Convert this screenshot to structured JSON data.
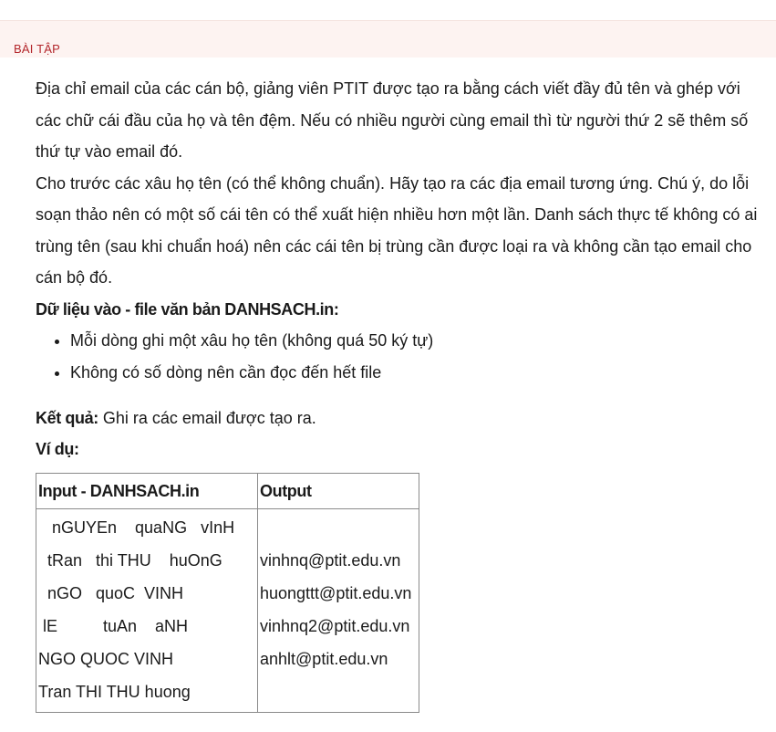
{
  "section": {
    "label": "BÀI TẬP"
  },
  "problem": {
    "paragraph1": "Địa chỉ email của các cán bộ, giảng viên PTIT được tạo ra bằng cách viết đầy đủ tên và ghép với các chữ cái đầu của họ và tên đệm. Nếu có nhiều người cùng email thì từ người thứ 2 sẽ thêm số thứ tự vào email đó.",
    "paragraph2": "Cho trước các xâu họ tên (có thể không chuẩn). Hãy tạo ra các địa email tương ứng. Chú ý, do lỗi soạn thảo nên có một số cái tên có thể xuất hiện nhiều hơn một lần. Danh sách thực tế không có ai trùng tên (sau khi chuẩn hoá) nên các cái tên bị trùng cần được loại ra và không cần tạo email cho cán bộ đó.",
    "input_heading": "Dữ liệu vào - file văn bản DANHSACH.in:",
    "input_items": [
      "Mỗi dòng ghi một xâu họ tên (không quá 50 ký tự)",
      "Không có số dòng nên cần đọc đến hết file"
    ],
    "result_label": "Kết quả:",
    "result_text": " Ghi ra các email được tạo ra.",
    "example_label": "Ví dụ:"
  },
  "example_table": {
    "headers": [
      "Input - DANHSACH.in",
      "Output"
    ],
    "input_lines": [
      "   nGUYEn    quaNG   vInH",
      "  tRan   thi THU    huOnG",
      "  nGO   quoC  VINH",
      " lE          tuAn    aNH",
      "NGO QUOC VINH",
      "Tran THI THU huong"
    ],
    "output_lines": [
      "",
      "vinhnq@ptit.edu.vn",
      "huongttt@ptit.edu.vn",
      "vinhnq2@ptit.edu.vn",
      "anhlt@ptit.edu.vn",
      ""
    ]
  }
}
